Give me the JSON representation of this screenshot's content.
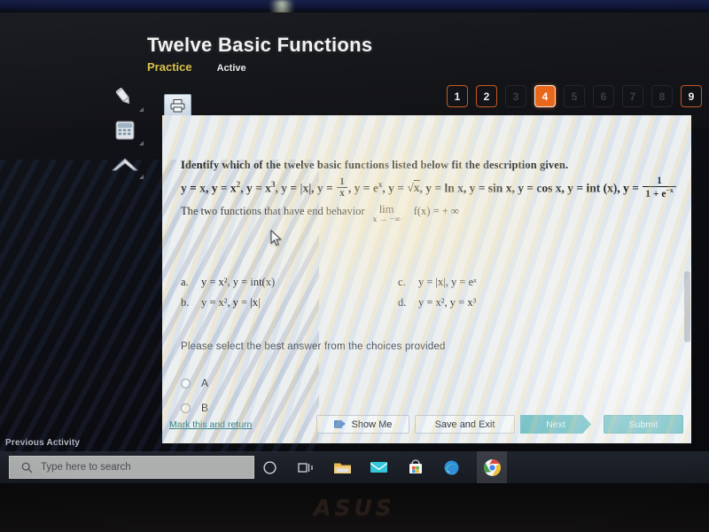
{
  "device": {
    "brand_logo": "ASUS"
  },
  "header": {
    "title": "Twelve Basic Functions",
    "practice_label": "Practice",
    "active_label": "Active"
  },
  "tool_rail": {
    "items": [
      {
        "name": "highlighter-icon",
        "label": "Highlighter"
      },
      {
        "name": "calculator-icon",
        "label": "Calculator"
      },
      {
        "name": "formula-icon",
        "label": "Reference"
      }
    ]
  },
  "print_button": {
    "label": "Print"
  },
  "question_nav": {
    "items": [
      {
        "number": "1",
        "state": "seen"
      },
      {
        "number": "2",
        "state": "seen"
      },
      {
        "number": "3",
        "state": "unseen"
      },
      {
        "number": "4",
        "state": "current"
      },
      {
        "number": "5",
        "state": "unseen"
      },
      {
        "number": "6",
        "state": "unseen"
      },
      {
        "number": "7",
        "state": "unseen"
      },
      {
        "number": "8",
        "state": "unseen"
      },
      {
        "number": "9",
        "state": "seen"
      }
    ],
    "current": "4",
    "active_color": "#e8671b"
  },
  "question": {
    "stem": "Identify which of the twelve basic functions listed below fit the description given.",
    "function_list_plain": "y = x, y = x2, y = x3, y = |x|, y = 1/x, y = ex, y = √x, y = ln x, y = sin x, y = cos x, y = int (x), y = 1/(1 + e-x)",
    "end_behavior_prefix": "The two functions that have end behavior",
    "limit_top": "lim",
    "limit_bottom": "x → −∞",
    "limit_result": "f(x) = + ∞",
    "prompt": "Please select the best answer from the choices provided",
    "choices": [
      {
        "letter": "a.",
        "text": "y = x², y = int(x)"
      },
      {
        "letter": "b.",
        "text": "y = x², y = |x|"
      },
      {
        "letter": "c.",
        "text": "y = |x|, y = eˣ"
      },
      {
        "letter": "d.",
        "text": "y = x², y = x³"
      }
    ],
    "radio_options": [
      {
        "label": "A",
        "selected": false
      },
      {
        "label": "B",
        "selected": false
      }
    ]
  },
  "actions": {
    "mark_link": "Mark this and return",
    "show_me": "Show Me",
    "save_and_exit": "Save and Exit",
    "next": "Next",
    "submit": "Submit",
    "teal": "#62b9bd"
  },
  "previous_activity": "Previous Activity",
  "taskbar": {
    "search_placeholder": "Type here to search",
    "icons": [
      {
        "name": "cortana-icon"
      },
      {
        "name": "task-view-icon"
      },
      {
        "name": "file-explorer-icon"
      },
      {
        "name": "mail-icon"
      },
      {
        "name": "microsoft-store-icon"
      },
      {
        "name": "edge-icon"
      },
      {
        "name": "chrome-icon",
        "active": true
      }
    ]
  }
}
